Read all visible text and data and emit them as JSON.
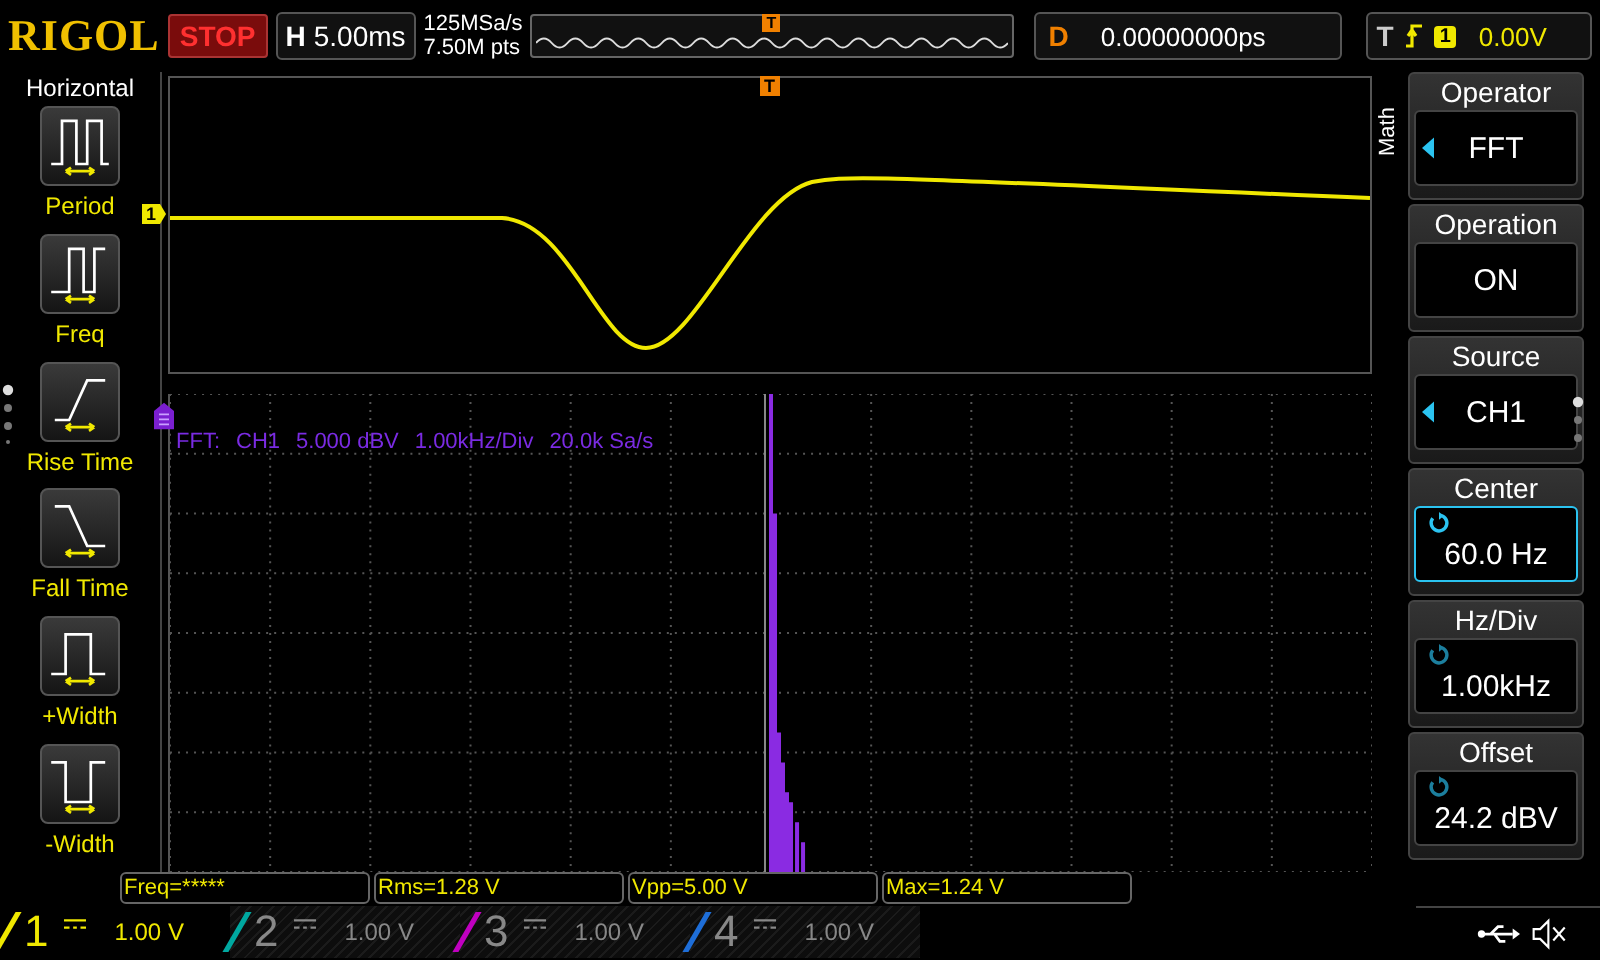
{
  "header": {
    "logo": "RIGOL",
    "run_state": "STOP",
    "timebase": {
      "label": "H",
      "value": "5.00ms"
    },
    "sample_rate": "125MSa/s",
    "memory_depth": "7.50M pts",
    "trigger_marker": "T",
    "delay": {
      "label": "D",
      "value": "0.00000000ps"
    },
    "trigger": {
      "label": "T",
      "channel": "1",
      "level": "0.00V"
    }
  },
  "left_menu": {
    "title": "Horizontal",
    "items": [
      {
        "label": "Period",
        "kind": "period"
      },
      {
        "label": "Freq",
        "kind": "freq"
      },
      {
        "label": "Rise Time",
        "kind": "rise"
      },
      {
        "label": "Fall Time",
        "kind": "fall"
      },
      {
        "label": "+Width",
        "kind": "pwidth"
      },
      {
        "label": "-Width",
        "kind": "nwidth"
      }
    ]
  },
  "waveform": {
    "channel_marker": "1",
    "trigger_marker": "T"
  },
  "fft": {
    "labels": [
      "FFT:",
      "CH1",
      "5.000 dBV",
      "1.00kHz/Div",
      "20.0k Sa/s"
    ]
  },
  "right_menu": {
    "title": "Math",
    "items": [
      {
        "title": "Operator",
        "value": "FFT",
        "kind": "select",
        "selected": false
      },
      {
        "title": "Operation",
        "value": "ON",
        "kind": "plain",
        "selected": false
      },
      {
        "title": "Source",
        "value": "CH1",
        "kind": "select",
        "selected": false
      },
      {
        "title": "Center",
        "value": "60.0 Hz",
        "kind": "knob",
        "selected": true
      },
      {
        "title": "Hz/Div",
        "value": "1.00kHz",
        "kind": "knob",
        "selected": false
      },
      {
        "title": "Offset",
        "value": "24.2 dBV",
        "kind": "knob",
        "selected": false
      }
    ]
  },
  "measurements": [
    "Freq=*****",
    "Rms=1.28 V",
    "Vpp=5.00 V",
    "Max=1.24 V"
  ],
  "channels": [
    {
      "number": "1",
      "scale": "1.00 V",
      "on": true,
      "color": "#f0e800"
    },
    {
      "number": "2",
      "scale": "1.00 V",
      "on": false,
      "color": "#00a8a0"
    },
    {
      "number": "3",
      "scale": "1.00 V",
      "on": false,
      "color": "#c000c0"
    },
    {
      "number": "4",
      "scale": "1.00 V",
      "on": false,
      "color": "#1e6ed8"
    }
  ]
}
